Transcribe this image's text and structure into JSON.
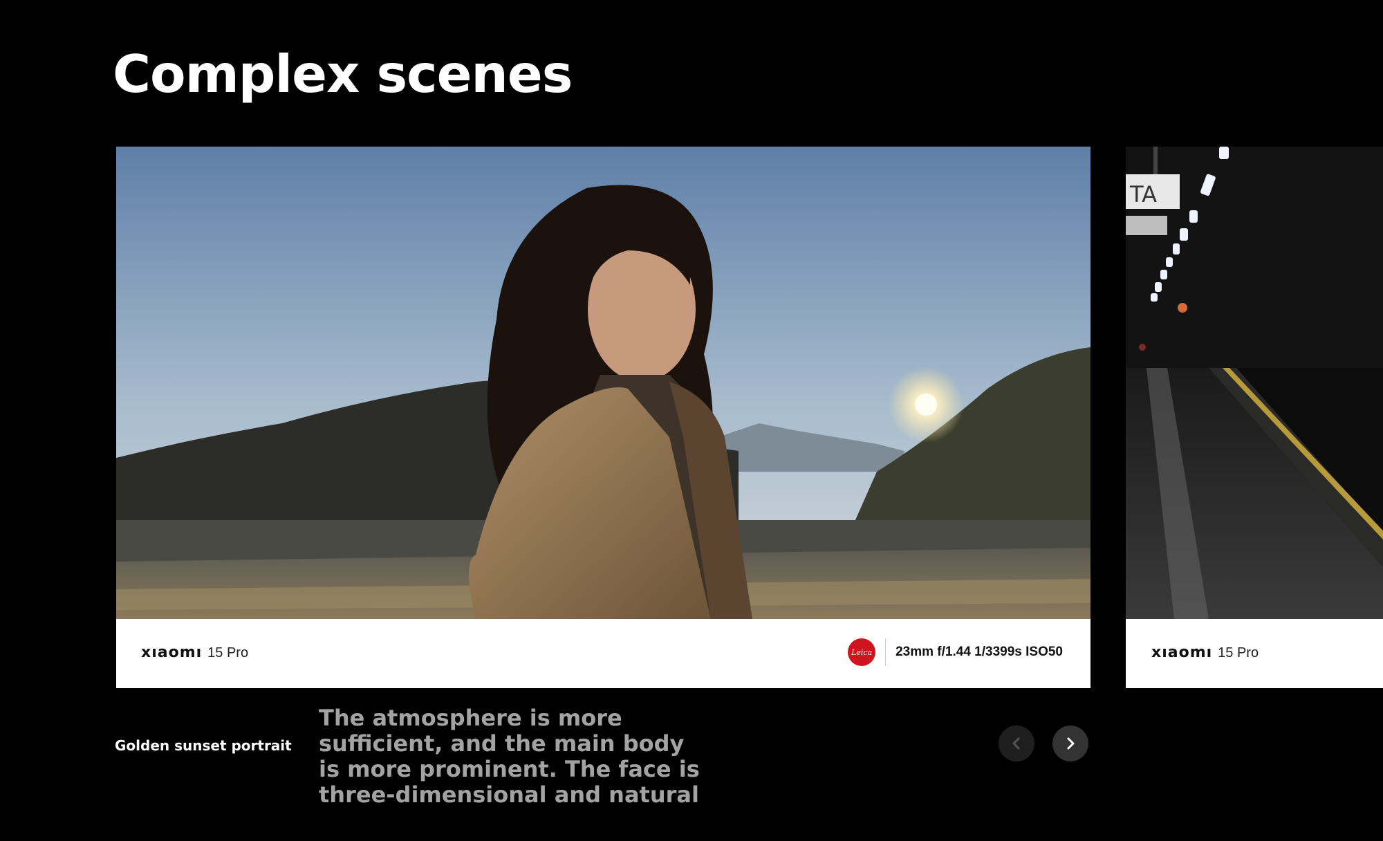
{
  "section": {
    "title": "Complex scenes"
  },
  "slides": [
    {
      "brand": "xıaomı",
      "model": "15 Pro",
      "leica_logo": "Leica",
      "exif": "23mm f/1.44 1/3399s ISO50",
      "caption": "Golden sunset portrait",
      "description": "The atmosphere is more sufficient, and the main body is more prominent. The face is three-dimensional and natural"
    },
    {
      "brand": "xıaomı",
      "model": "15 Pro"
    }
  ],
  "nav": {
    "prev_icon": "chevron-left-icon",
    "next_icon": "chevron-right-icon"
  },
  "colors": {
    "background": "#000000",
    "leica_red": "#d0141f",
    "description_gray": "#a3a3a3"
  }
}
